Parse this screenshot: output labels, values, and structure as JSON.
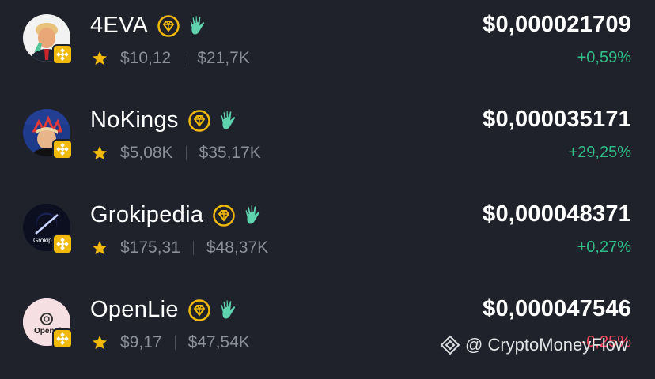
{
  "colors": {
    "background": "#1f222b",
    "positive": "#2ebd85",
    "negative": "#f6465d",
    "muted_text": "#8b8f99",
    "star": "#f0b90b",
    "gem_badge": "#f0b90b",
    "hand_badge": "#5fd3ad"
  },
  "tokens": [
    {
      "name": "4EVA",
      "rating_icon": "star-icon",
      "stat1": "$10,12",
      "stat2": "$21,7K",
      "price": "$0,000021709",
      "change": "+0,59%",
      "change_direction": "positive"
    },
    {
      "name": "NoKings",
      "rating_icon": "star-icon",
      "stat1": "$5,08K",
      "stat2": "$35,17K",
      "price": "$0,000035171",
      "change": "+29,25%",
      "change_direction": "positive"
    },
    {
      "name": "Grokipedia",
      "avatar_text": "Grokip",
      "rating_icon": "star-icon",
      "stat1": "$175,31",
      "stat2": "$48,37K",
      "price": "$0,000048371",
      "change": "+0,27%",
      "change_direction": "positive"
    },
    {
      "name": "OpenLie",
      "avatar_text": "OpenLi",
      "rating_icon": "star-icon",
      "stat1": "$9,17",
      "stat2": "$47,54K",
      "price": "$0,000047546",
      "change": "-0,25%",
      "change_direction": "negative"
    }
  ],
  "watermark": {
    "text": "@ CryptoMoneyFlow",
    "icon": "binance-diamond-icon"
  }
}
